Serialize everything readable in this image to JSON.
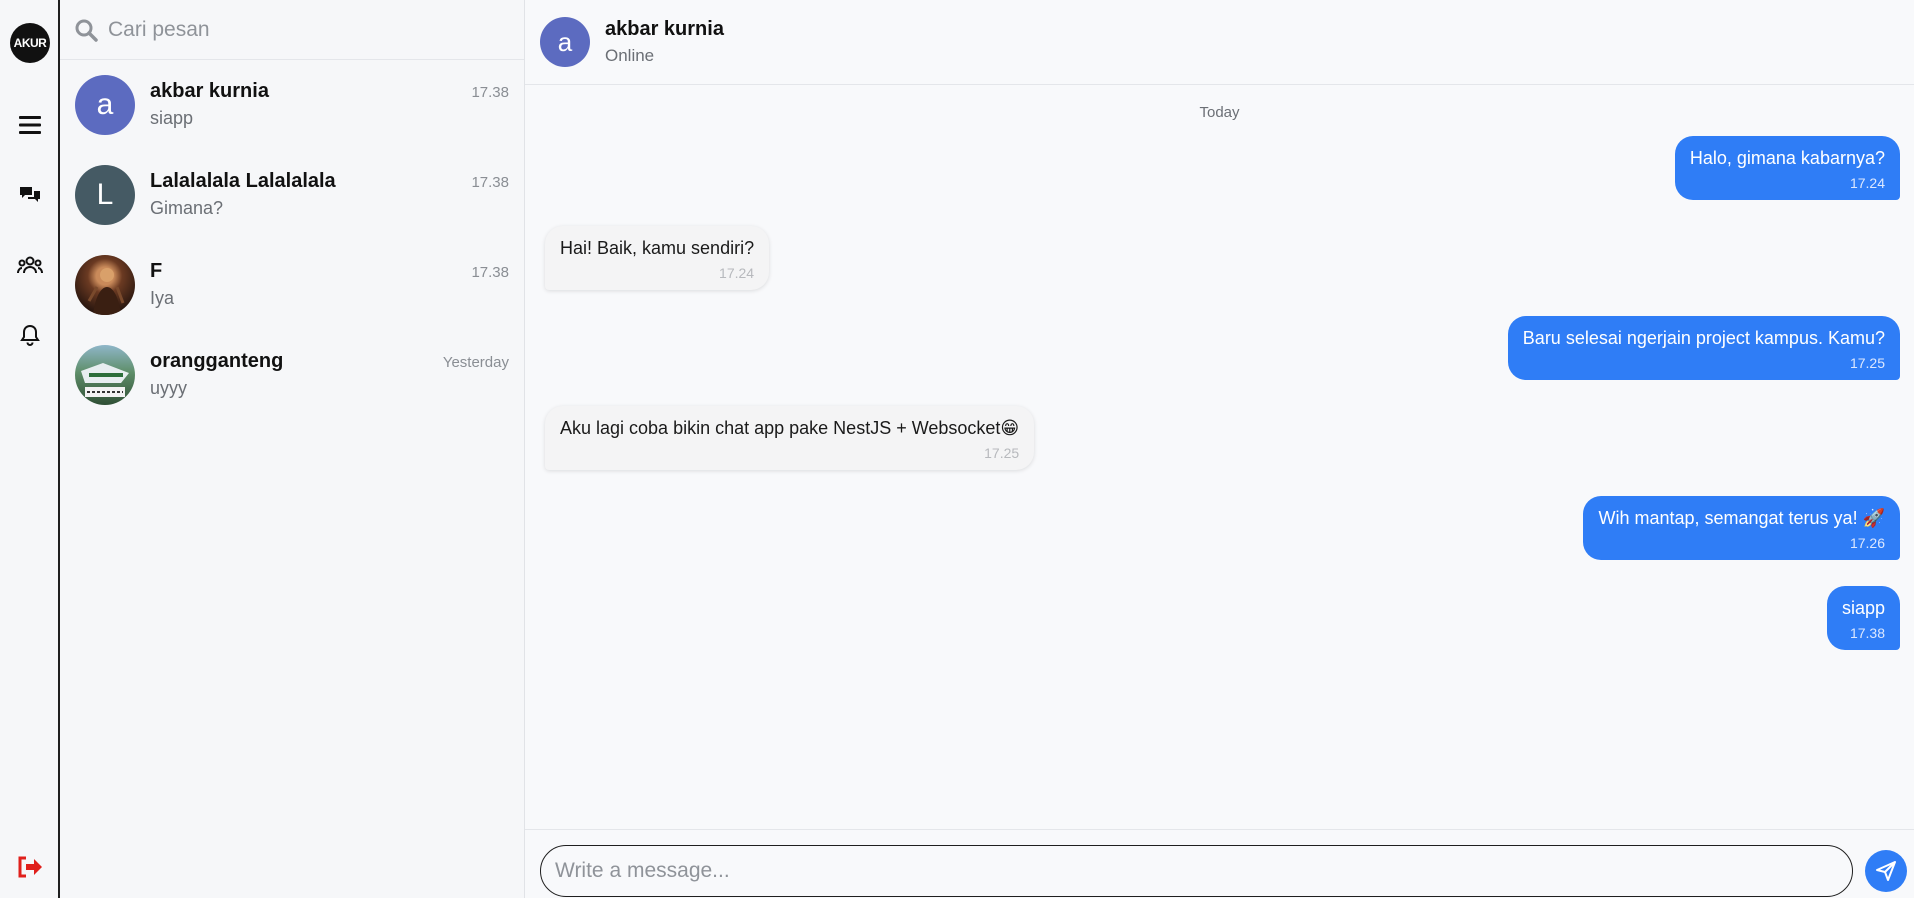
{
  "rail": {
    "logo_text": "AKUR",
    "items": [
      "menu-icon",
      "chat-icon",
      "group-icon",
      "bell-icon"
    ],
    "logout_icon": "logout-icon",
    "logout_color": "#e0201c"
  },
  "search": {
    "placeholder": "Cari pesan"
  },
  "conversations": [
    {
      "initial": "a",
      "name": "akbar kurnia",
      "preview": "siapp",
      "time": "17.38",
      "avatar_color": "#5c6bc0"
    },
    {
      "initial": "L",
      "name": "Lalalalala Lalalalala",
      "preview": "Gimana?",
      "time": "17.38",
      "avatar_color": "#455a64"
    },
    {
      "initial": "",
      "name": "F",
      "preview": "Iya",
      "time": "17.38",
      "avatar_color": "#5a3520"
    },
    {
      "initial": "",
      "name": "orangganteng",
      "preview": "uyyy",
      "time": "Yesterday",
      "avatar_color": "#3f6e4f"
    }
  ],
  "chat": {
    "contact_initial": "a",
    "contact_name": "akbar kurnia",
    "contact_status": "Online",
    "day_label": "Today",
    "messages": [
      {
        "dir": "out",
        "text": "Halo, gimana kabarnya?",
        "time": "17.24"
      },
      {
        "dir": "in",
        "text": "Hai! Baik, kamu sendiri?",
        "time": "17.24"
      },
      {
        "dir": "out",
        "text": "Baru selesai ngerjain project kampus. Kamu?",
        "time": "17.25"
      },
      {
        "dir": "in",
        "text": "Aku lagi coba bikin chat app pake NestJS + Websocket😁",
        "time": "17.25"
      },
      {
        "dir": "out",
        "text": "Wih mantap, semangat terus ya! 🚀",
        "time": "17.26"
      },
      {
        "dir": "out",
        "text": "siapp",
        "time": "17.38"
      }
    ]
  },
  "composer": {
    "placeholder": "Write a message...",
    "accent": "#2f7df6"
  }
}
